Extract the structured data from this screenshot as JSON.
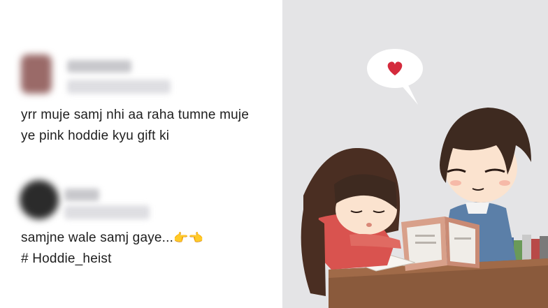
{
  "comments": [
    {
      "line1": "yrr muje samj nhi aa raha tumne muje",
      "line2": "ye pink hoddie kyu gift ki"
    },
    {
      "line1": "samjne wale samj gaye...",
      "line1_emoji": "👉👈",
      "line2": "# Hoddie_heist"
    }
  ],
  "illustration": {
    "speech_bubble_icon": "heart-icon",
    "colors": {
      "background": "#e4e4e6",
      "heart": "#d42a3c",
      "boy_sweater": "#5b7fa8",
      "girl_top": "#d9534f",
      "hair": "#4a2e22",
      "table": "#8a5a3c"
    }
  }
}
